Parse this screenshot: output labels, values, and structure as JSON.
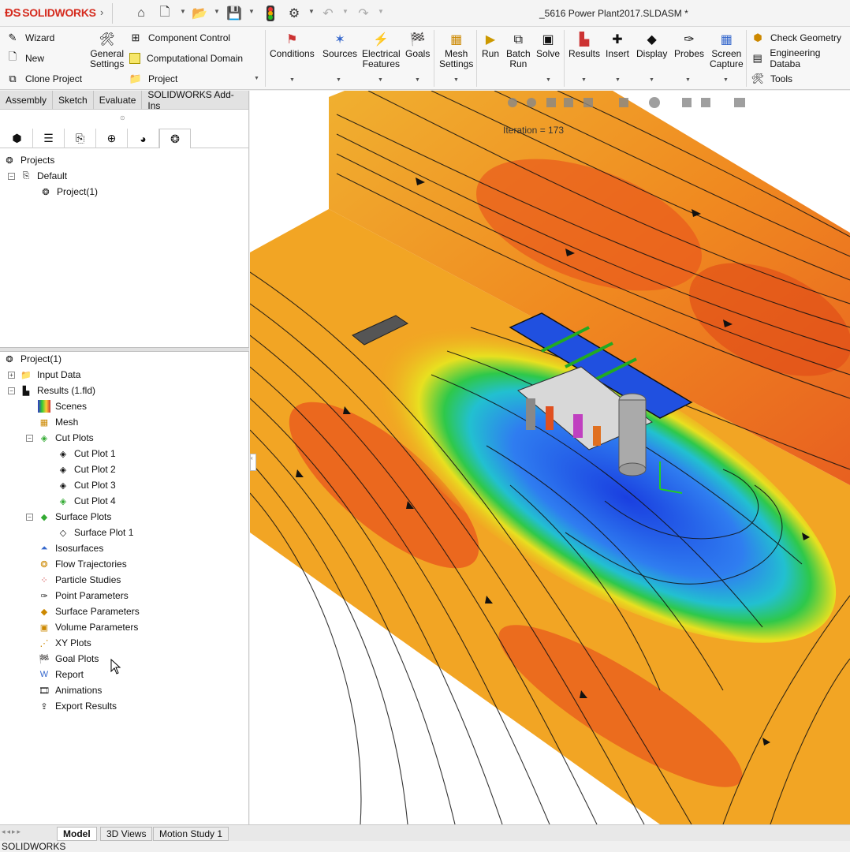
{
  "app": {
    "logo_text": "SOLIDWORKS",
    "document_title": "_5616 Power Plant2017.SLDASM *",
    "status_text": "SOLIDWORKS"
  },
  "ribbon": {
    "wizard": "Wizard",
    "new": "New",
    "clone_project": "Clone Project",
    "general_settings_1": "General",
    "general_settings_2": "Settings",
    "component_control": "Component Control",
    "computational_domain": "Computational Domain",
    "project": "Project",
    "conditions": "Conditions",
    "sources": "Sources",
    "electrical_1": "Electrical",
    "electrical_2": "Features",
    "goals": "Goals",
    "mesh_1": "Mesh",
    "mesh_2": "Settings",
    "run": "Run",
    "batch_1": "Batch",
    "batch_2": "Run",
    "solve": "Solve",
    "results": "Results",
    "insert": "Insert",
    "display": "Display",
    "probes": "Probes",
    "screen_1": "Screen",
    "screen_2": "Capture",
    "check_geometry": "Check Geometry",
    "engineering_database": "Engineering Databa",
    "tools": "Tools"
  },
  "cm_tabs": [
    "Assembly",
    "Sketch",
    "Evaluate",
    "SOLIDWORKS Add-Ins"
  ],
  "top_tree": {
    "projects": "Projects",
    "default": "Default",
    "project1": "Project(1)"
  },
  "analysis_tree": {
    "root": "Project(1)",
    "input_data": "Input Data",
    "results": "Results (1.fld)",
    "scenes": "Scenes",
    "mesh": "Mesh",
    "cut_plots": "Cut Plots",
    "cut_plot_1": "Cut Plot 1",
    "cut_plot_2": "Cut Plot 2",
    "cut_plot_3": "Cut Plot 3",
    "cut_plot_4": "Cut Plot 4",
    "surface_plots": "Surface Plots",
    "surface_plot_1": "Surface Plot 1",
    "isosurfaces": "Isosurfaces",
    "flow_trajectories": "Flow Trajectories",
    "particle_studies": "Particle Studies",
    "point_parameters": "Point Parameters",
    "surface_parameters": "Surface Parameters",
    "volume_parameters": "Volume Parameters",
    "xy_plots": "XY Plots",
    "goal_plots": "Goal Plots",
    "report": "Report",
    "animations": "Animations",
    "export_results": "Export Results"
  },
  "viewport": {
    "iteration_label": "Iteration = 173"
  },
  "bottom_tabs": [
    "Model",
    "3D Views",
    "Motion Study 1"
  ],
  "colors": {
    "accent_red": "#d52b1e",
    "flow_orange": "#f0a020",
    "flow_blue": "#1f5fe0"
  }
}
